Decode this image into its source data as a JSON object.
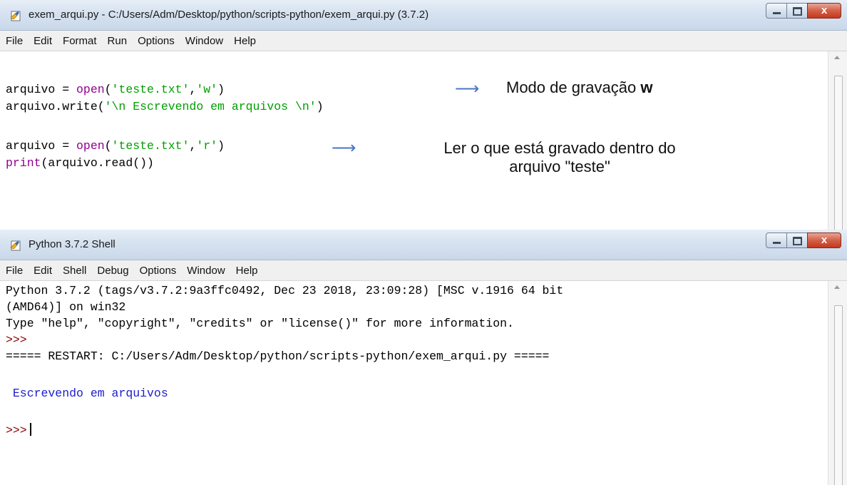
{
  "editor": {
    "title": "exem_arqui.py - C:/Users/Adm/Desktop/python/scripts-python/exem_arqui.py (3.7.2)",
    "menu": [
      "File",
      "Edit",
      "Format",
      "Run",
      "Options",
      "Window",
      "Help"
    ],
    "code": {
      "line1": {
        "pre": "arquivo = ",
        "fn": "open",
        "args_a": "(",
        "s1": "'teste.txt'",
        "comma": ",",
        "s2": "'w'",
        "args_b": ")"
      },
      "line2": {
        "pre": "arquivo.write(",
        "s": "'\\n Escrevendo em arquivos \\n'",
        "post": ")"
      },
      "line3": {
        "pre": "arquivo = ",
        "fn": "open",
        "args_a": "(",
        "s1": "'teste.txt'",
        "comma": ",",
        "s2": "'r'",
        "args_b": ")"
      },
      "line4": {
        "fn": "print",
        "post": "(arquivo.read())"
      }
    },
    "annotations": {
      "arrow_glyph": "⟶",
      "note1_text": "Modo de gravação ",
      "note1_bold": "w",
      "note2_line1": "Ler o que está gravado dentro do",
      "note2_line2": "arquivo \"teste\""
    }
  },
  "shell": {
    "title": "Python 3.7.2 Shell",
    "menu": [
      "File",
      "Edit",
      "Shell",
      "Debug",
      "Options",
      "Window",
      "Help"
    ],
    "lines": {
      "banner1": "Python 3.7.2 (tags/v3.7.2:9a3ffc0492, Dec 23 2018, 23:09:28) [MSC v.1916 64 bit",
      "banner2": "(AMD64)] on win32",
      "banner3": "Type \"help\", \"copyright\", \"credits\" or \"license()\" for more information.",
      "prompt": ">>>",
      "restart": "===== RESTART: C:/Users/Adm/Desktop/python/scripts-python/exem_arqui.py =====",
      "output": " Escrevendo em arquivos",
      "prompt2": ">>>"
    }
  },
  "caption_buttons": {
    "close_glyph": "x"
  },
  "colors": {
    "string": "#00a000",
    "builtin": "#900090",
    "output": "#1c1ccf",
    "prompt": "#8b0000",
    "arrow": "#4a76c2"
  }
}
